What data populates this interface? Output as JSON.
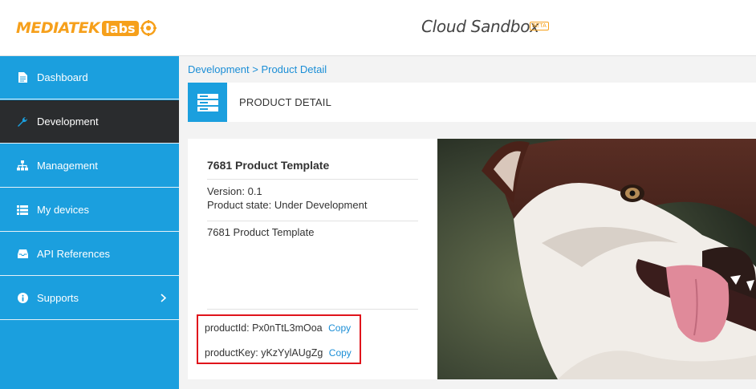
{
  "header": {
    "logo_main": "MEDIATEK",
    "logo_labs": "labs",
    "app_title": "Cloud Sandbox",
    "beta_badge": "BETA"
  },
  "sidebar": {
    "items": [
      {
        "label": "Dashboard",
        "icon": "file-icon"
      },
      {
        "label": "Development",
        "icon": "wrench-icon"
      },
      {
        "label": "Management",
        "icon": "sitemap-icon"
      },
      {
        "label": "My devices",
        "icon": "list-icon"
      },
      {
        "label": "API References",
        "icon": "inbox-icon"
      },
      {
        "label": "Supports",
        "icon": "info-icon"
      }
    ],
    "active_index": 1
  },
  "breadcrumb": {
    "parent": "Development",
    "separator": ">",
    "current": "Product Detail"
  },
  "page": {
    "title": "PRODUCT DETAIL",
    "icon": "server-icon"
  },
  "product": {
    "name": "7681 Product Template",
    "version_line": "Version: 0.1",
    "state_line": "Product state: Under Development",
    "description": "7681 Product Template",
    "product_id_label": "productId:",
    "product_id": "Px0nTtL3mOoa",
    "product_key_label": "productKey:",
    "product_key": "yKzYylAUgZg",
    "copy_label": "Copy"
  },
  "colors": {
    "sidebar": "#1b9fde",
    "sidebar_active": "#2a2c2e",
    "brand_orange": "#f6a01b",
    "link": "#1b8ed6",
    "highlight_border": "#e0141b"
  }
}
